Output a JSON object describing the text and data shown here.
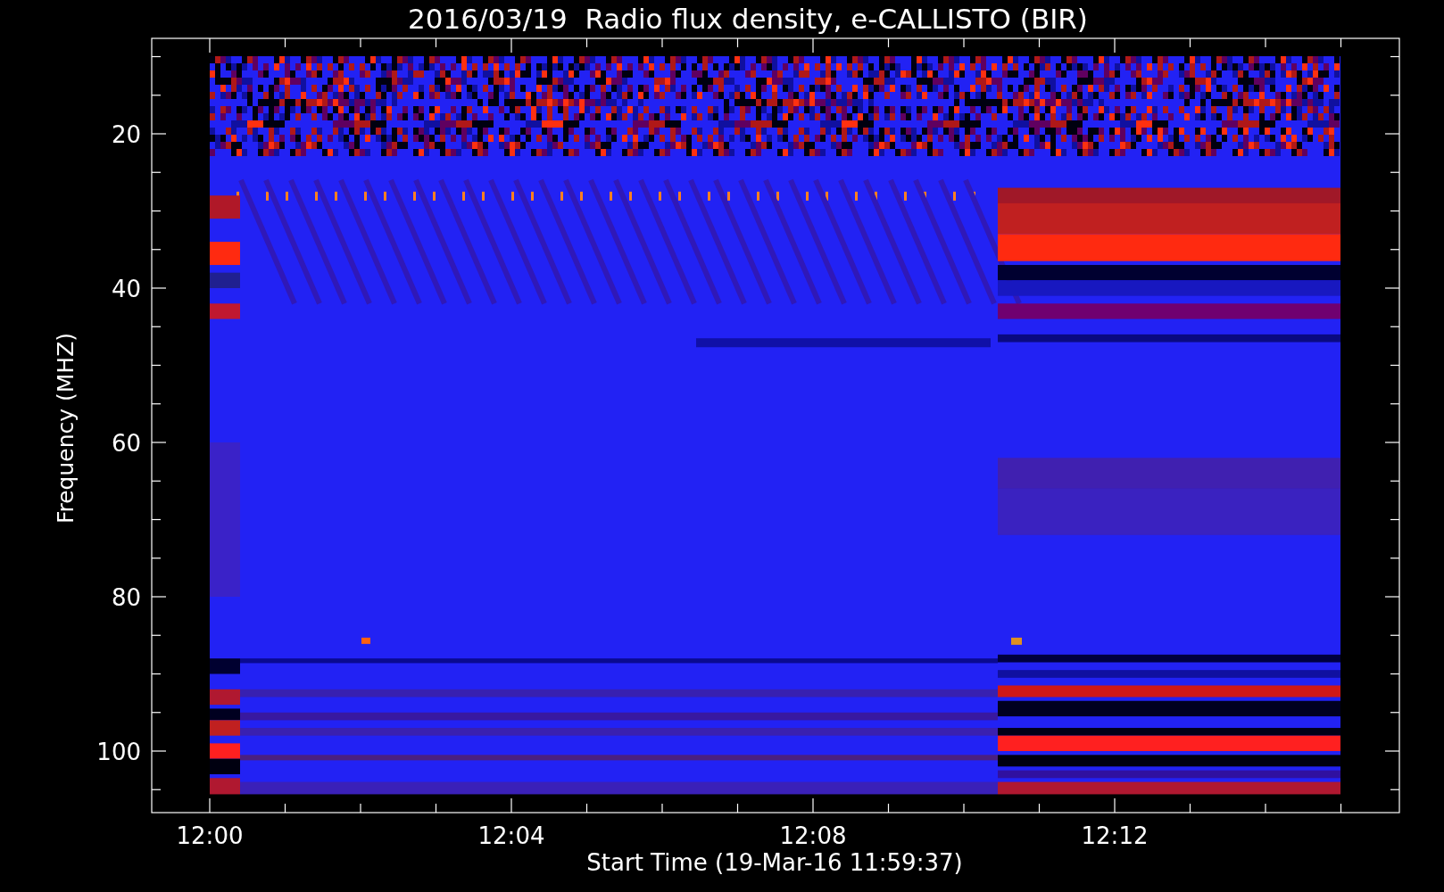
{
  "title": "2016/03/19  Radio flux density, e-CALLISTO (BIR)",
  "y_axis": {
    "label": "Frequency (MHZ)",
    "ticks": [
      "20",
      "40",
      "60",
      "80",
      "100"
    ]
  },
  "x_axis": {
    "label": "Start Time (19-Mar-16 11:59:37)",
    "ticks": [
      "12:00",
      "12:04",
      "12:08",
      "12:12"
    ]
  }
}
